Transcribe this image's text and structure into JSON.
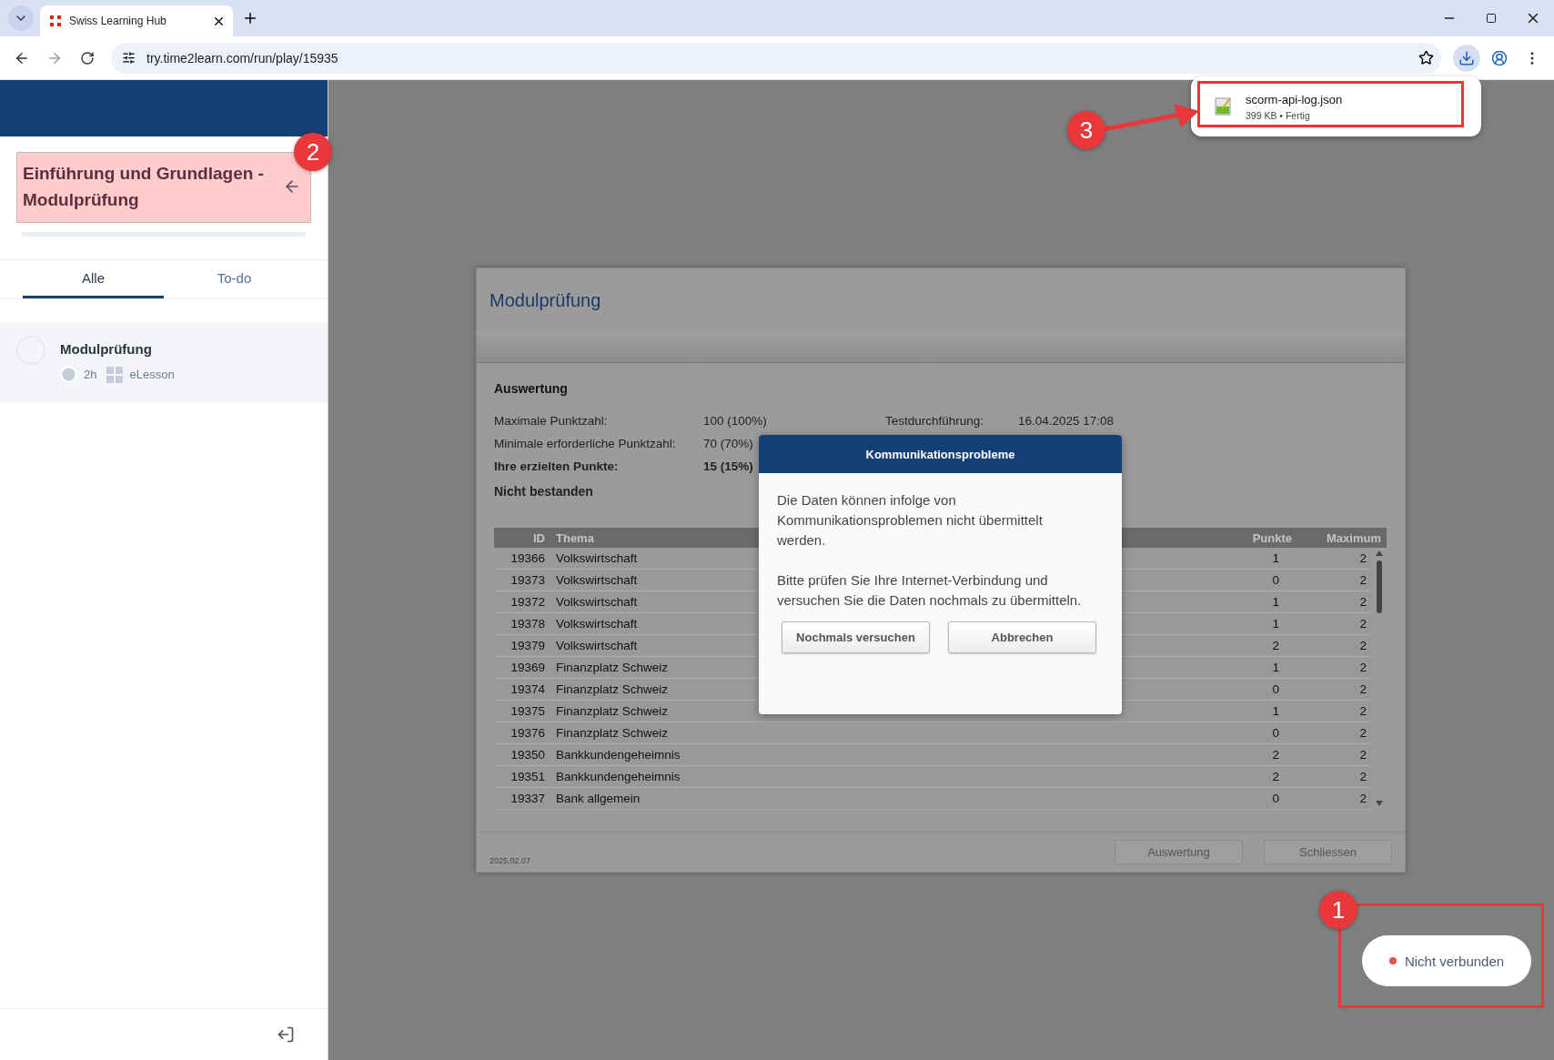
{
  "browser": {
    "tab_title": "Swiss Learning Hub",
    "url": "try.time2learn.com/run/play/15935"
  },
  "download": {
    "file_name": "scorm-api-log.json",
    "details": "399 KB • Fertig"
  },
  "sidebar": {
    "course_title": "Einführung und Grundlagen - Modulprüfung",
    "tabs": [
      {
        "label": "Alle",
        "selected": true
      },
      {
        "label": "To-do",
        "selected": false
      }
    ],
    "items": [
      {
        "title": "Modulprüfung",
        "duration": "2h",
        "type": "eLesson",
        "completed": false
      }
    ]
  },
  "exam": {
    "title": "Modulprüfung",
    "section": "Auswertung",
    "summary": [
      {
        "label": "Maximale Punktzahl:",
        "value": "100 (100%)",
        "bold": false
      },
      {
        "label": "Minimale erforderliche Punktzahl:",
        "value": "70 (70%)",
        "bold": false
      },
      {
        "label": "Ihre erzielten Punkte:",
        "value": "15 (15%)",
        "bold": true
      }
    ],
    "extra": {
      "label": "Testdurchführung:",
      "value": "16.04.2025 17:08"
    },
    "result": "Nicht bestanden",
    "table": {
      "columns": [
        "ID",
        "Thema",
        "Punkte",
        "Maximum"
      ],
      "rows": [
        [
          "19366",
          "Volkswirtschaft",
          "1",
          "2"
        ],
        [
          "19373",
          "Volkswirtschaft",
          "0",
          "2"
        ],
        [
          "19372",
          "Volkswirtschaft",
          "1",
          "2"
        ],
        [
          "19378",
          "Volkswirtschaft",
          "1",
          "2"
        ],
        [
          "19379",
          "Volkswirtschaft",
          "2",
          "2"
        ],
        [
          "19369",
          "Finanzplatz Schweiz",
          "1",
          "2"
        ],
        [
          "19374",
          "Finanzplatz Schweiz",
          "0",
          "2"
        ],
        [
          "19375",
          "Finanzplatz Schweiz",
          "1",
          "2"
        ],
        [
          "19376",
          "Finanzplatz Schweiz",
          "0",
          "2"
        ],
        [
          "19350",
          "Bankkundengeheimnis",
          "2",
          "2"
        ],
        [
          "19351",
          "Bankkundengeheimnis",
          "2",
          "2"
        ],
        [
          "19337",
          "Bank allgemein",
          "0",
          "2"
        ]
      ]
    },
    "version": "2025.02.07",
    "buttons": [
      "Auswertung",
      "Schliessen"
    ]
  },
  "dialog": {
    "title": "Kommunikationsprobleme",
    "paragraphs": [
      "Die Daten können infolge von Kommunikationsproblemen nicht übermittelt werden.",
      "Bitte prüfen Sie Ihre Internet-Verbindung und versuchen Sie die Daten nochmals zu übermitteln."
    ],
    "buttons": [
      "Nochmals versuchen",
      "Abbrechen"
    ]
  },
  "connection": {
    "label": "Nicht verbunden",
    "color": "#d9534f"
  },
  "annotations": [
    {
      "label": "1"
    },
    {
      "label": "2"
    },
    {
      "label": "3"
    }
  ]
}
